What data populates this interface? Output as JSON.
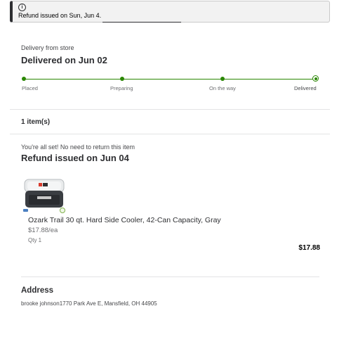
{
  "banner": {
    "icon": "info-icon",
    "message": "Refund issued on Sun, Jun 4."
  },
  "delivery": {
    "method": "Delivery from store",
    "status": "Delivered on Jun 02",
    "steps": [
      "Placed",
      "Preparing",
      "On the way",
      "Delivered"
    ],
    "current_step": "Delivered",
    "accent_color": "#2a8703"
  },
  "items": {
    "count_label": "1 item(s)",
    "return_note": "You're all set! No need to return this item",
    "refund_status": "Refund issued on Jun 04",
    "list": [
      {
        "name": "Ozark Trail 30 qt. Hard Side Cooler, 42-Can Capacity, Gray",
        "unit_price": "$17.88/ea",
        "qty": "Qty 1",
        "total": "$17.88",
        "image_icon": "cooler-image"
      }
    ]
  },
  "address": {
    "title": "Address",
    "line": "brooke johnson1770 Park Ave E, Mansfield, OH 44905"
  }
}
